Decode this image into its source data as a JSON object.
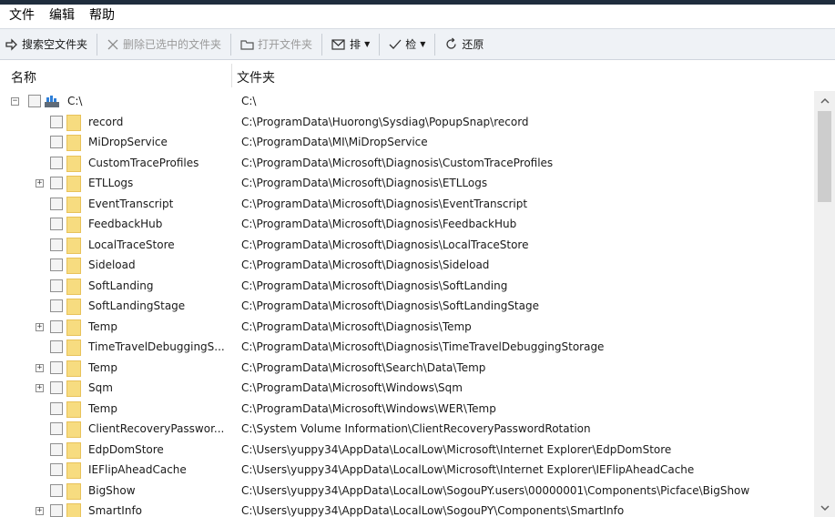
{
  "menu": [
    "文件",
    "编辑",
    "帮助"
  ],
  "toolbar": {
    "search": "搜索空文件夹",
    "delete_selected": "删除已选中的文件夹",
    "open_folder": "打开文件夹",
    "select": "排",
    "check": "检",
    "restore": "还原"
  },
  "columns": {
    "name": "名称",
    "folder": "文件夹"
  },
  "rows": [
    {
      "name": "C:\\",
      "path": "C:\\",
      "level": 0,
      "expander": "minus",
      "drive": true
    },
    {
      "name": "record",
      "path": "C:\\ProgramData\\Huorong\\Sysdiag\\PopupSnap\\record",
      "level": 1,
      "expander": ""
    },
    {
      "name": "MiDropService",
      "path": "C:\\ProgramData\\MI\\MiDropService",
      "level": 1,
      "expander": ""
    },
    {
      "name": "CustomTraceProfiles",
      "path": "C:\\ProgramData\\Microsoft\\Diagnosis\\CustomTraceProfiles",
      "level": 1,
      "expander": ""
    },
    {
      "name": "ETLLogs",
      "path": "C:\\ProgramData\\Microsoft\\Diagnosis\\ETLLogs",
      "level": 1,
      "expander": "plus"
    },
    {
      "name": "EventTranscript",
      "path": "C:\\ProgramData\\Microsoft\\Diagnosis\\EventTranscript",
      "level": 1,
      "expander": ""
    },
    {
      "name": "FeedbackHub",
      "path": "C:\\ProgramData\\Microsoft\\Diagnosis\\FeedbackHub",
      "level": 1,
      "expander": ""
    },
    {
      "name": "LocalTraceStore",
      "path": "C:\\ProgramData\\Microsoft\\Diagnosis\\LocalTraceStore",
      "level": 1,
      "expander": ""
    },
    {
      "name": "Sideload",
      "path": "C:\\ProgramData\\Microsoft\\Diagnosis\\Sideload",
      "level": 1,
      "expander": ""
    },
    {
      "name": "SoftLanding",
      "path": "C:\\ProgramData\\Microsoft\\Diagnosis\\SoftLanding",
      "level": 1,
      "expander": ""
    },
    {
      "name": "SoftLandingStage",
      "path": "C:\\ProgramData\\Microsoft\\Diagnosis\\SoftLandingStage",
      "level": 1,
      "expander": ""
    },
    {
      "name": "Temp",
      "path": "C:\\ProgramData\\Microsoft\\Diagnosis\\Temp",
      "level": 1,
      "expander": "plus"
    },
    {
      "name": "TimeTravelDebuggingS...",
      "path": "C:\\ProgramData\\Microsoft\\Diagnosis\\TimeTravelDebuggingStorage",
      "level": 1,
      "expander": ""
    },
    {
      "name": "Temp",
      "path": "C:\\ProgramData\\Microsoft\\Search\\Data\\Temp",
      "level": 1,
      "expander": "plus"
    },
    {
      "name": "Sqm",
      "path": "C:\\ProgramData\\Microsoft\\Windows\\Sqm",
      "level": 1,
      "expander": "plus"
    },
    {
      "name": "Temp",
      "path": "C:\\ProgramData\\Microsoft\\Windows\\WER\\Temp",
      "level": 1,
      "expander": ""
    },
    {
      "name": "ClientRecoveryPasswor...",
      "path": "C:\\System Volume Information\\ClientRecoveryPasswordRotation",
      "level": 1,
      "expander": ""
    },
    {
      "name": "EdpDomStore",
      "path": "C:\\Users\\yuppy34\\AppData\\LocalLow\\Microsoft\\Internet Explorer\\EdpDomStore",
      "level": 1,
      "expander": ""
    },
    {
      "name": "IEFlipAheadCache",
      "path": "C:\\Users\\yuppy34\\AppData\\LocalLow\\Microsoft\\Internet Explorer\\IEFlipAheadCache",
      "level": 1,
      "expander": ""
    },
    {
      "name": "BigShow",
      "path": "C:\\Users\\yuppy34\\AppData\\LocalLow\\SogouPY.users\\00000001\\Components\\Picface\\BigShow",
      "level": 1,
      "expander": ""
    },
    {
      "name": "SmartInfo",
      "path": "C:\\Users\\yuppy34\\AppData\\LocalLow\\SogouPY\\Components\\SmartInfo",
      "level": 1,
      "expander": "plus"
    }
  ]
}
